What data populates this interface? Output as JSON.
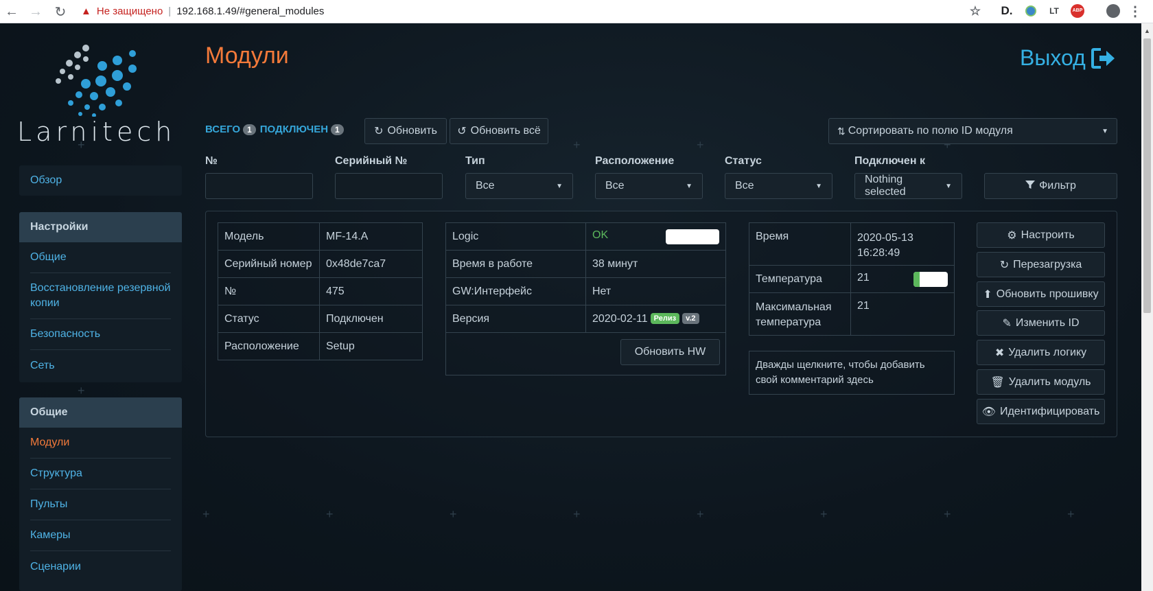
{
  "browser": {
    "insecure_label": "Не защищено",
    "url": "192.168.1.49/#general_modules",
    "ext_labels": [
      "D.",
      "ABP"
    ]
  },
  "logo": {
    "text": "Larnitech"
  },
  "sidebar": {
    "overview": "Обзор",
    "settings_header": "Настройки",
    "settings_items": [
      "Общие",
      "Восстановление резервной копии",
      "Безопасность",
      "Сеть"
    ],
    "general_header": "Общие",
    "general_items": [
      "Модули",
      "Структура",
      "Пульты",
      "Камеры",
      "Сценарии"
    ]
  },
  "header": {
    "title": "Модули",
    "logout": "Выход"
  },
  "toolbar": {
    "total_label": "ВСЕГО",
    "total_count": "1",
    "connected_label": "ПОДКЛЮЧЕН",
    "connected_count": "1",
    "refresh": "Обновить",
    "refresh_all": "Обновить всё",
    "sort": "Сортировать по полю ID модуля"
  },
  "filters": {
    "labels": [
      "№",
      "Серийный №",
      "Тип",
      "Расположение",
      "Статус",
      "Подключен к"
    ],
    "type_value": "Все",
    "location_value": "Все",
    "status_value": "Все",
    "connected_to_value": "Nothing selected",
    "filter_button": "Фильтр"
  },
  "module": {
    "info": [
      {
        "k": "Модель",
        "v": "MF-14.A"
      },
      {
        "k": "Серийный номер",
        "v": "0x48de7ca7"
      },
      {
        "k": "№",
        "v": "475"
      },
      {
        "k": "Статус",
        "v": "Подключен"
      },
      {
        "k": "Расположение",
        "v": "Setup"
      }
    ],
    "logic_label": "Logic",
    "logic_value": "OK",
    "uptime_label": "Время в работе",
    "uptime_value": "38 минут",
    "gw_label": "GW:Интерфейс",
    "gw_value": "Нет",
    "version_label": "Версия",
    "version_value": "2020-02-11",
    "release_tag": "Релиз",
    "version_tag": "v.2",
    "update_hw": "Обновить HW",
    "time_label": "Время",
    "time_value_date": "2020-05-13",
    "time_value_time": "16:28:49",
    "temp_label": "Температура",
    "temp_value": "21",
    "maxtemp_label_1": "Максимальная",
    "maxtemp_label_2": "температура",
    "maxtemp_value": "21",
    "comment": "Дважды щелкните, чтобы добавить свой комментарий здесь",
    "actions": [
      "Настроить",
      "Перезагрузка",
      "Обновить прошивку",
      "Изменить ID",
      "Удалить логику",
      "Удалить модуль",
      "Идентифицировать"
    ]
  },
  "colors": {
    "accent_orange": "#f47a3a",
    "link_blue": "#4fb3e6",
    "ok_green": "#5cb85c"
  }
}
